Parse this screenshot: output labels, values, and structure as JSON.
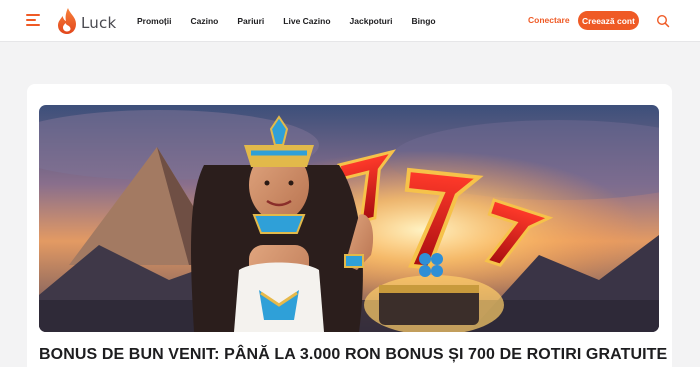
{
  "header": {
    "logo_text": "Luck",
    "nav": [
      "Promoții",
      "Cazino",
      "Pariuri",
      "Live Cazino",
      "Jackpoturi",
      "Bingo"
    ],
    "login_label": "Conectare",
    "register_label": "Creează cont",
    "icons": {
      "menu": "hamburger-menu-icon",
      "logo": "flame-logo-icon",
      "search": "search-icon"
    }
  },
  "promo": {
    "headline": "BONUS DE BUN VENIT: PÂNĂ LA 3.000 RON BONUS ȘI 700 DE ROTIRI GRATUITE"
  },
  "colors": {
    "accent": "#ef5a25",
    "background": "#f3f3f4",
    "text": "#1d1d1f"
  }
}
